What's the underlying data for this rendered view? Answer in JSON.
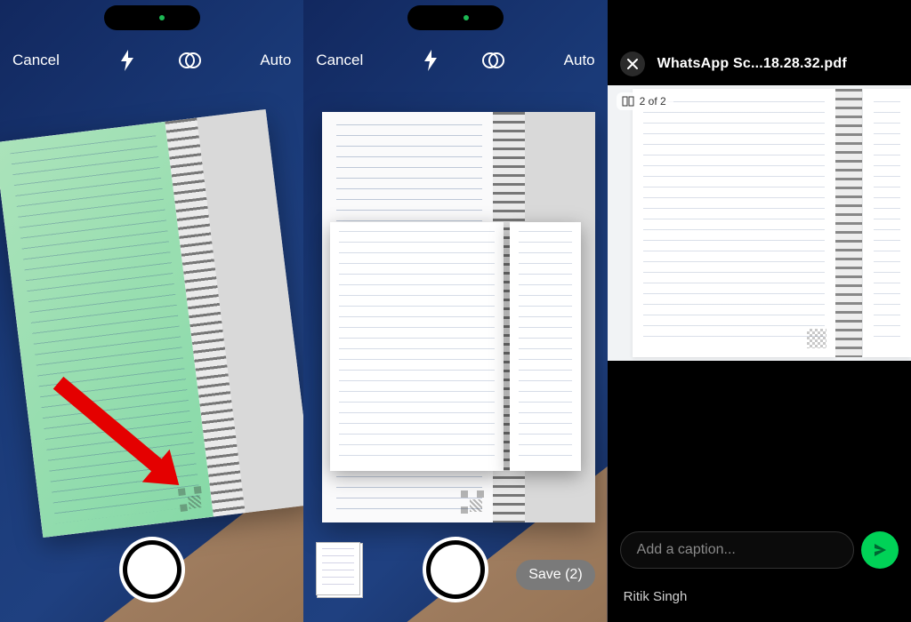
{
  "scanner": {
    "cancel": "Cancel",
    "auto": "Auto",
    "save_label": "Save (2)"
  },
  "whatsapp": {
    "filename": "WhatsApp Sc...18.28.32.pdf",
    "page_indicator": "2 of 2",
    "caption_placeholder": "Add a caption...",
    "recipient": "Ritik Singh"
  }
}
